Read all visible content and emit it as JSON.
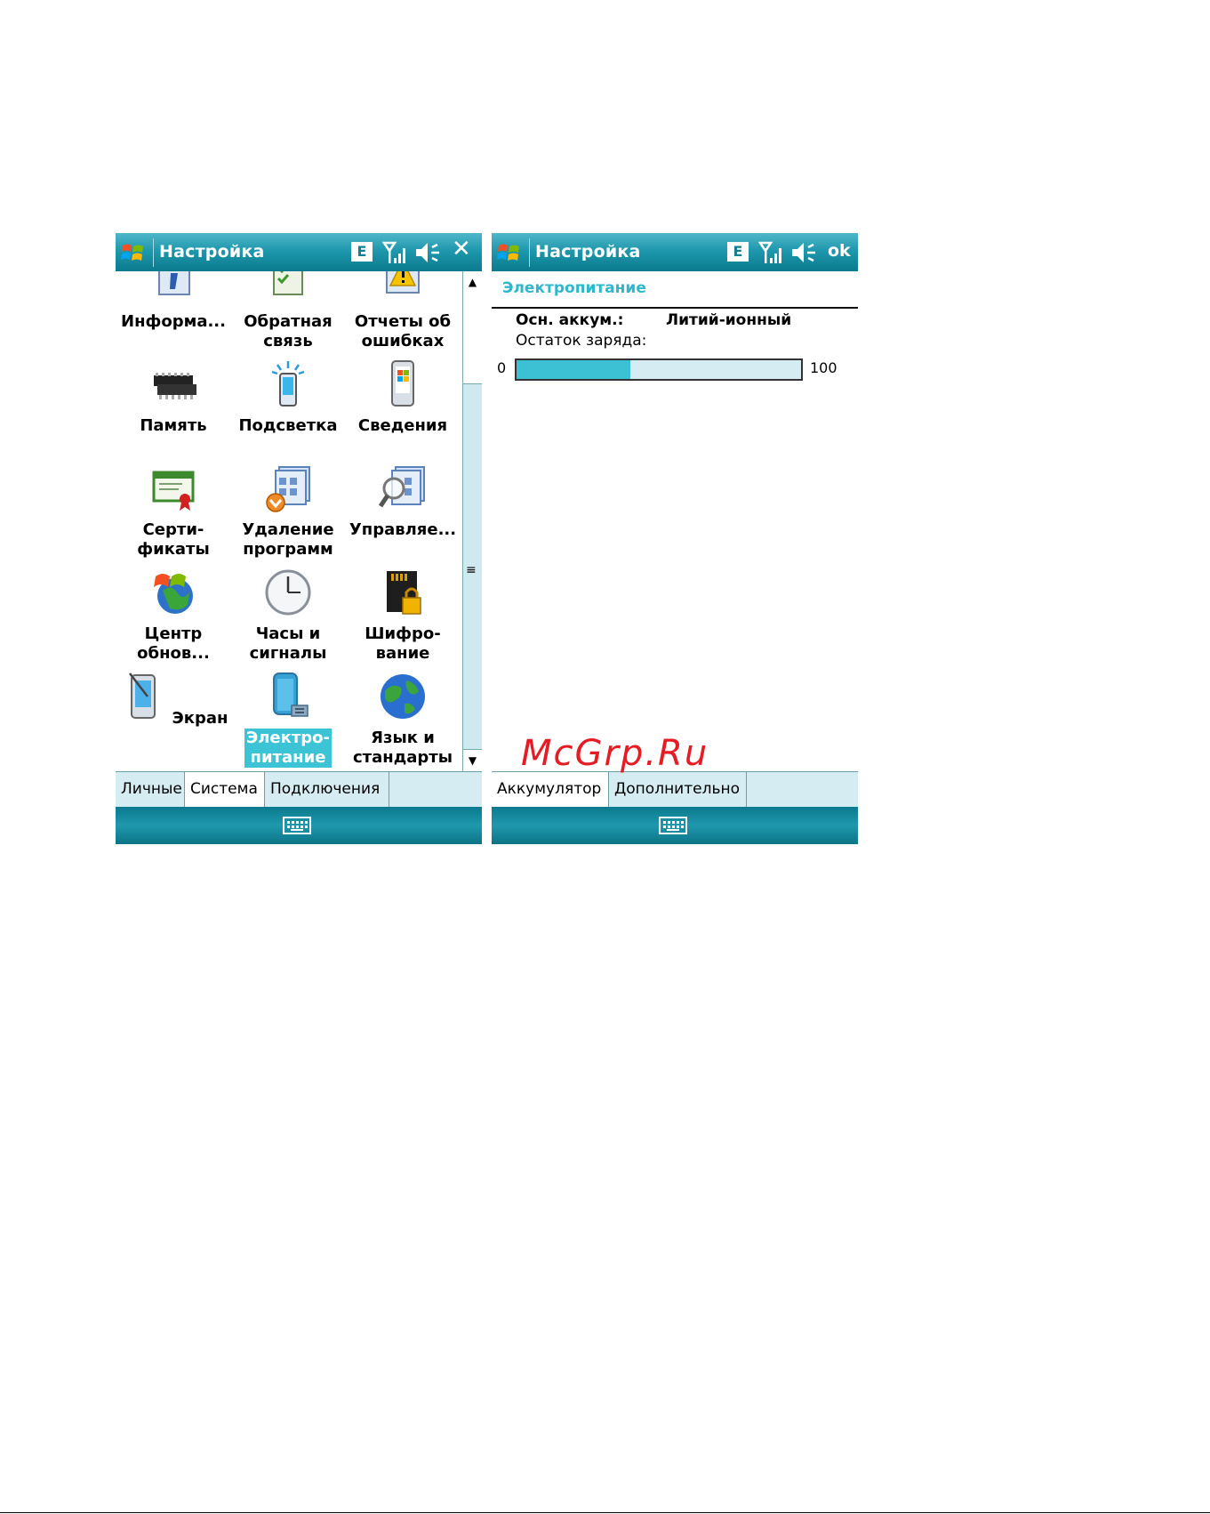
{
  "watermark": "McGrp.Ru",
  "left": {
    "title": "Настройка",
    "e_badge": "E",
    "close": "✕",
    "icons": [
      {
        "label": "Информа...",
        "icon": "info-icon"
      },
      {
        "label": "Обратная\nсвязь",
        "icon": "feedback-icon"
      },
      {
        "label": "Отчеты об\nошибках",
        "icon": "error-report-icon"
      },
      {
        "label": "Память",
        "icon": "memory-icon"
      },
      {
        "label": "Подсветка",
        "icon": "backlight-icon"
      },
      {
        "label": "Сведения",
        "icon": "about-icon"
      },
      {
        "label": "Серти-\nфикаты",
        "icon": "certificates-icon"
      },
      {
        "label": "Удаление\nпрограмм",
        "icon": "remove-programs-icon"
      },
      {
        "label": "Управляе...",
        "icon": "managed-programs-icon"
      },
      {
        "label": "Центр\nобнов...",
        "icon": "update-center-icon"
      },
      {
        "label": "Часы и\nсигналы",
        "icon": "clock-icon"
      },
      {
        "label": "Шифро-\nвание",
        "icon": "encryption-icon"
      },
      {
        "label": "Экран",
        "icon": "screen-icon"
      },
      {
        "label": "Электро-\nпитание",
        "icon": "power-icon",
        "selected": true
      },
      {
        "label": "Язык и\nстандарты",
        "icon": "globe-icon"
      }
    ],
    "tabs": [
      "Личные",
      "Система",
      "Подключения"
    ],
    "active_tab": "Система"
  },
  "right": {
    "title": "Настройка",
    "e_badge": "E",
    "ok": "ok",
    "section_title": "Электропитание",
    "battery_label": "Осн. аккум.:",
    "battery_type": "Литий-ионный",
    "remaining_label": "Остаток заряда:",
    "scale_min": "0",
    "scale_max": "100",
    "charge_fraction": 0.4,
    "tabs": [
      "Аккумулятор",
      "Дополнительно"
    ],
    "active_tab": "Аккумулятор"
  },
  "colors": {
    "accent": "#3cc0d3",
    "titlebar": "#1f98ad",
    "watermark": "#e51c23"
  }
}
